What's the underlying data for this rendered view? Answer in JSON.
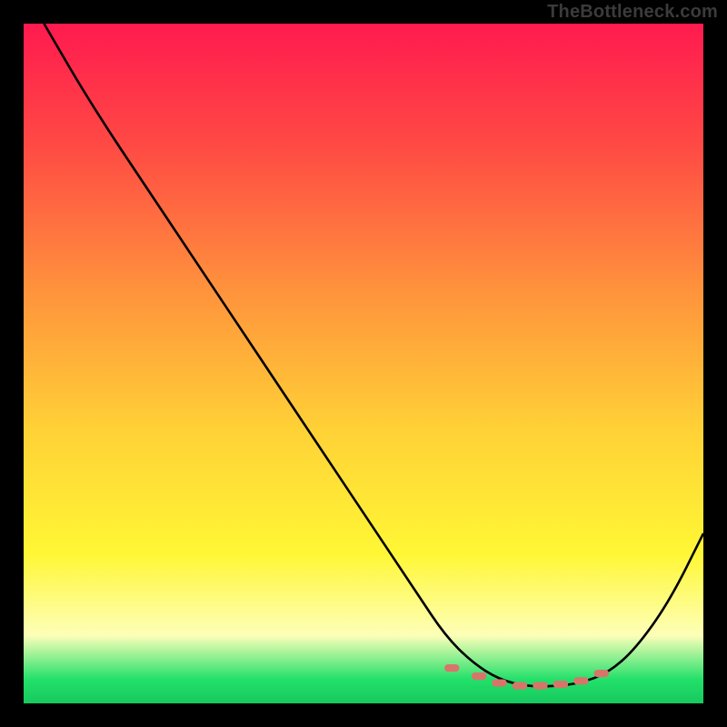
{
  "watermark": "TheBottleneck.com",
  "gradient_stops": [
    {
      "offset": 0,
      "color": "#ff1a4f"
    },
    {
      "offset": 0.18,
      "color": "#ff4a44"
    },
    {
      "offset": 0.4,
      "color": "#ff953c"
    },
    {
      "offset": 0.6,
      "color": "#ffd236"
    },
    {
      "offset": 0.78,
      "color": "#fff735"
    },
    {
      "offset": 0.9,
      "color": "#fdffb8"
    },
    {
      "offset": 0.965,
      "color": "#22e06a"
    },
    {
      "offset": 1.0,
      "color": "#17c95e"
    }
  ],
  "curve_color": "#000000",
  "marker_color": "#d9746a",
  "chart_data": {
    "type": "line",
    "title": "",
    "xlabel": "",
    "ylabel": "",
    "xlim": [
      0,
      100
    ],
    "ylim": [
      0,
      100
    ],
    "series": [
      {
        "name": "bottleneck-curve",
        "x": [
          3,
          10,
          20,
          30,
          40,
          50,
          58,
          62,
          66,
          70,
          74,
          78,
          82,
          86,
          90,
          95,
          100
        ],
        "y": [
          100,
          88,
          73,
          58,
          43,
          28,
          16,
          10,
          6,
          3.5,
          2.5,
          2.5,
          3,
          4.5,
          8,
          15,
          25
        ]
      }
    ],
    "markers": {
      "name": "highlight-band",
      "x": [
        63,
        67,
        70,
        73,
        76,
        79,
        82,
        85
      ],
      "y": [
        5.2,
        4.0,
        3.0,
        2.6,
        2.6,
        2.8,
        3.3,
        4.4
      ]
    }
  }
}
